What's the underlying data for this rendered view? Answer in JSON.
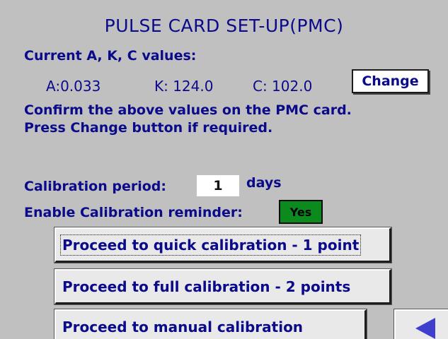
{
  "title": "PULSE CARD SET-UP(PMC)",
  "current_values": {
    "heading": "Current A, K, C values:",
    "a_text": "A:0.033",
    "k_text": "K: 124.0",
    "c_text": "C: 102.0",
    "change_label": "Change"
  },
  "instructions": {
    "line1": "Confirm the above values on the PMC card.",
    "line2": "Press Change button if required."
  },
  "calibration": {
    "period_label": "Calibration period:",
    "period_value": "1",
    "period_unit": "days",
    "reminder_label": "Enable Calibration reminder:",
    "reminder_value": "Yes",
    "reminder_color": "#0d8a1d"
  },
  "actions": {
    "quick": "Proceed to quick calibration - 1 point",
    "full": "Proceed to full calibration - 2 points",
    "manual": "Proceed to manual calibration"
  },
  "nav": {
    "back_icon": "left-arrow-icon"
  },
  "colors": {
    "background": "#c0c0c0",
    "text": "#0a0a8a"
  }
}
